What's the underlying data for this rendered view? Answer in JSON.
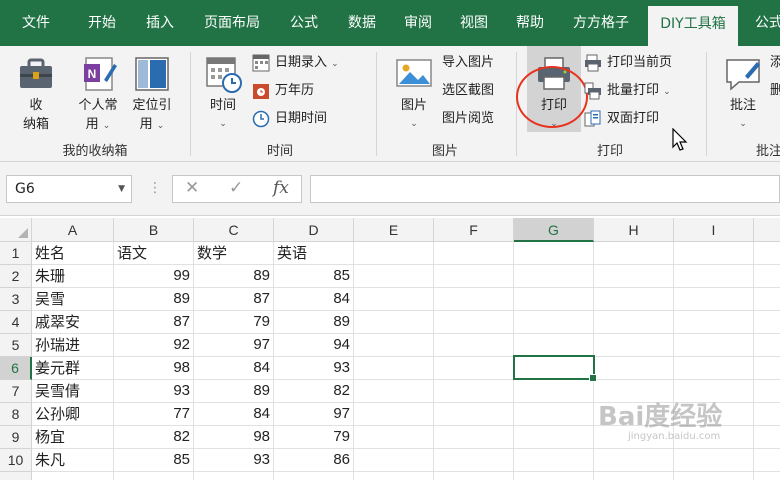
{
  "tabs": [
    {
      "label": "文件",
      "active": false
    },
    {
      "label": "开始",
      "active": false
    },
    {
      "label": "插入",
      "active": false
    },
    {
      "label": "页面布局",
      "active": false
    },
    {
      "label": "公式",
      "active": false
    },
    {
      "label": "数据",
      "active": false
    },
    {
      "label": "审阅",
      "active": false
    },
    {
      "label": "视图",
      "active": false
    },
    {
      "label": "帮助",
      "active": false
    },
    {
      "label": "方方格子",
      "active": false
    },
    {
      "label": "DIY工具箱",
      "active": true
    },
    {
      "label": "公式",
      "active": false
    }
  ],
  "ribbon": {
    "groups": {
      "shoucang": {
        "label": "我的收纳箱",
        "btn_storage": {
          "line1": "收",
          "line2": "纳箱"
        },
        "btn_personal": {
          "line1": "个人常",
          "line2": "用"
        },
        "btn_custom": {
          "line1": "定位引",
          "line2": "用"
        }
      },
      "time": {
        "label": "时间",
        "btn_time": "时间",
        "date_entry": "日期录入",
        "calendar": "万年历",
        "datetime": "日期时间"
      },
      "picture": {
        "label": "图片",
        "btn_picture": "图片",
        "import": "导入图片",
        "capture": "选区截图",
        "browse": "图片阅览"
      },
      "print": {
        "label": "打印",
        "btn_print": "打印",
        "current_page": "打印当前页",
        "batch": "批量打印",
        "duplex": "双面打印"
      },
      "comment": {
        "label": "批注",
        "btn_comment": "批注",
        "item1": "添",
        "item2": "删"
      }
    }
  },
  "formula_bar": {
    "name_box": "G6",
    "cancel": "✕",
    "enter": "✓",
    "fx": "fx",
    "value": ""
  },
  "sheet": {
    "columns": [
      "A",
      "B",
      "C",
      "D",
      "E",
      "F",
      "G",
      "H",
      "I"
    ],
    "selected_column": "G",
    "selected_row": 6,
    "selected_cell": "G6",
    "headers": [
      "姓名",
      "语文",
      "数学",
      "英语"
    ],
    "rows": [
      {
        "num": "1",
        "name": "姓名",
        "chinese": "语文",
        "math": "数学",
        "english": "英语"
      },
      {
        "num": "2",
        "name": "朱珊",
        "chinese": "99",
        "math": "89",
        "english": "85"
      },
      {
        "num": "3",
        "name": "吴雪",
        "chinese": "89",
        "math": "87",
        "english": "84"
      },
      {
        "num": "4",
        "name": "戚翠安",
        "chinese": "87",
        "math": "79",
        "english": "89"
      },
      {
        "num": "5",
        "name": "孙瑞进",
        "chinese": "92",
        "math": "97",
        "english": "94"
      },
      {
        "num": "6",
        "name": "姜元群",
        "chinese": "98",
        "math": "84",
        "english": "93"
      },
      {
        "num": "7",
        "name": "吴雪倩",
        "chinese": "93",
        "math": "89",
        "english": "82"
      },
      {
        "num": "8",
        "name": "公孙卿",
        "chinese": "77",
        "math": "84",
        "english": "97"
      },
      {
        "num": "9",
        "name": "杨宜",
        "chinese": "82",
        "math": "98",
        "english": "79"
      },
      {
        "num": "10",
        "name": "朱凡",
        "chinese": "85",
        "math": "93",
        "english": "86"
      }
    ]
  },
  "watermark": {
    "text": "Bai度经验",
    "sub": "jingyan.baidu.com"
  },
  "colors": {
    "accent": "#217346",
    "highlight_ring": "#e8321e"
  }
}
